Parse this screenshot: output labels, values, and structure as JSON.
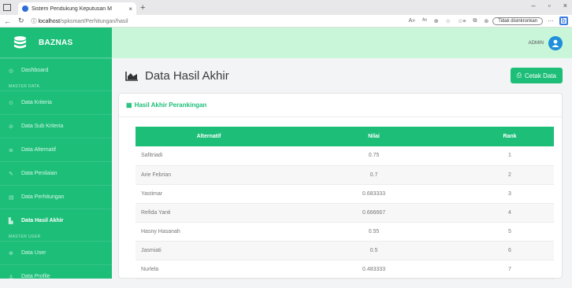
{
  "browser": {
    "tab_title": "Sistem Pendukung Keputusan M",
    "tab_close": "×",
    "new_tab": "+",
    "url_prefix": "ⓘ",
    "url_host": "localhost",
    "url_path": "/spksmart/Perhitungan/hasil",
    "sync_label": "Tidak disinkronkan",
    "more": "···",
    "edge_icon": "b"
  },
  "sidebar": {
    "brand": "BAZNAS",
    "items_top": [
      {
        "label": "Dashboard",
        "icon": "◎"
      }
    ],
    "section_master": "MASTER DATA",
    "items_master": [
      {
        "label": "Data Kriteria",
        "icon": "⊙"
      },
      {
        "label": "Data Sub Kriteria",
        "icon": "⊘"
      },
      {
        "label": "Data Alternatif",
        "icon": "≣"
      },
      {
        "label": "Data Penilaian",
        "icon": "✎"
      },
      {
        "label": "Data Perhitungan",
        "icon": "▤"
      },
      {
        "label": "Data Hasil Akhir",
        "icon": "▙",
        "active": true
      }
    ],
    "section_user": "MASTER USER",
    "items_user": [
      {
        "label": "Data User",
        "icon": "⊕"
      },
      {
        "label": "Data Profile",
        "icon": "♙"
      }
    ]
  },
  "topbar": {
    "user_name": "ADMIN"
  },
  "page": {
    "title": "Data Hasil Akhir",
    "print_button": "Cetak Data",
    "card_title": "Hasil Akhir Perankingan"
  },
  "table": {
    "headers": [
      "Alternatif",
      "Nilai",
      "Rank"
    ],
    "rows": [
      [
        "Safitriadi",
        "0.75",
        "1"
      ],
      [
        "Arie Febrian",
        "0.7",
        "2"
      ],
      [
        "Yastimar",
        "0.683333",
        "3"
      ],
      [
        "Refida Yanti",
        "0.666667",
        "4"
      ],
      [
        "Hasny Hasanah",
        "0.55",
        "5"
      ],
      [
        "Jasmiati",
        "0.5",
        "6"
      ],
      [
        "Nurlela",
        "0.483333",
        "7"
      ]
    ]
  },
  "colors": {
    "accent": "#1cbe78",
    "topbar": "#c9f5d9",
    "avatar": "#1e8fd8"
  }
}
